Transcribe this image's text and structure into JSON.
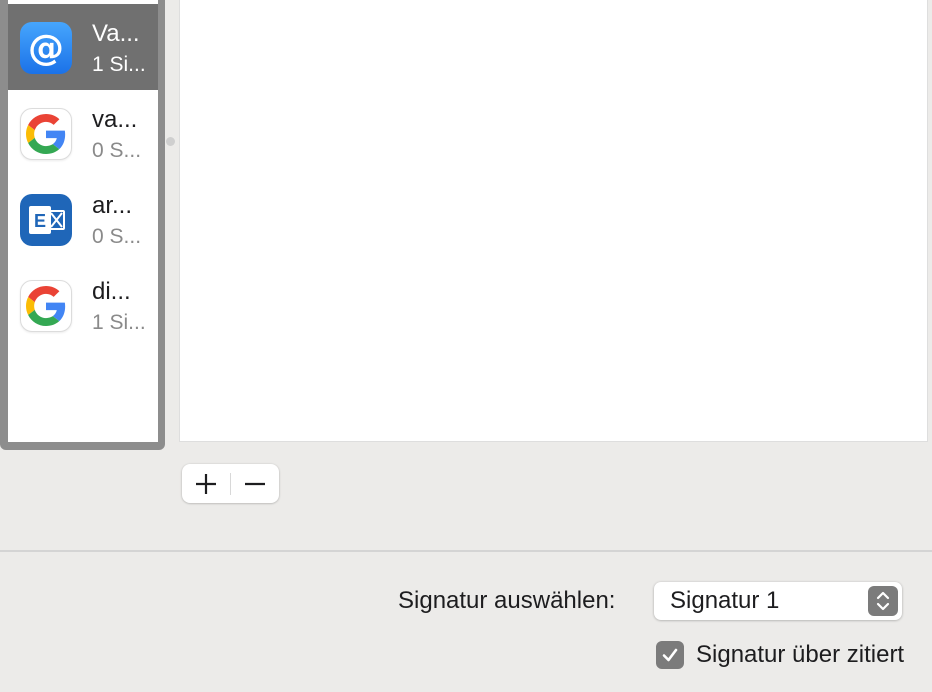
{
  "accounts": [
    {
      "name": "Va...",
      "count": "1 Si...",
      "icon": "at-sign-icon",
      "selected": true
    },
    {
      "name": "va...",
      "count": "0 S...",
      "icon": "google-icon",
      "selected": false
    },
    {
      "name": "ar...",
      "count": "0 S...",
      "icon": "exchange-icon",
      "selected": false
    },
    {
      "name": "di...",
      "count": "1 Si...",
      "icon": "google-icon",
      "selected": false
    }
  ],
  "toolbar": {
    "add_label": "+",
    "remove_label": "−"
  },
  "signature_select": {
    "label": "Signatur auswählen:",
    "value": "Signatur 1"
  },
  "quote_option": {
    "label": "Signatur über zitiert",
    "checked": true
  },
  "colors": {
    "selection": "#707070",
    "window_bg": "#ecebe9",
    "panel_border": "#8d8d8d"
  }
}
